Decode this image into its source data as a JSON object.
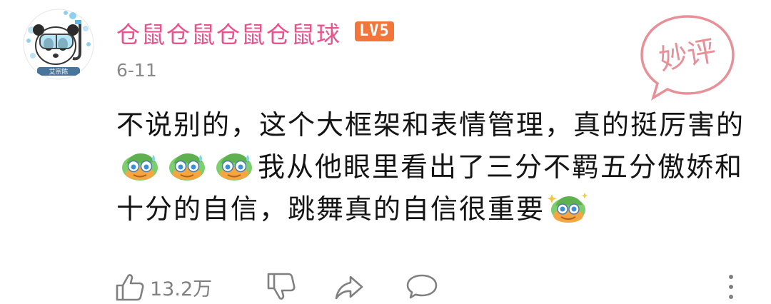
{
  "comment": {
    "username": "仓鼠仓鼠仓鼠仓鼠球",
    "level": "LV5",
    "date": "6-11",
    "stamp_text": "妙评",
    "avatar_text": "艾宗陈",
    "content": {
      "part1": "不说别的，这个大框架和表情管理，真的挺厉害的",
      "part2": "我从他眼里看出了三分不羁五分傲娇和十分的自信，跳舞真的自信很重要"
    },
    "emojis": [
      "sweat-smile-sticker",
      "sweat-smile-sticker",
      "sweat-smile-sticker",
      "proud-sticker"
    ],
    "actions": {
      "like_count": "13.2万"
    }
  },
  "colors": {
    "username": "#e8538e",
    "level_badge": "#f2763a",
    "stamp": "#e89098",
    "meta_gray": "#8a8a8a",
    "content_text": "#141414"
  }
}
